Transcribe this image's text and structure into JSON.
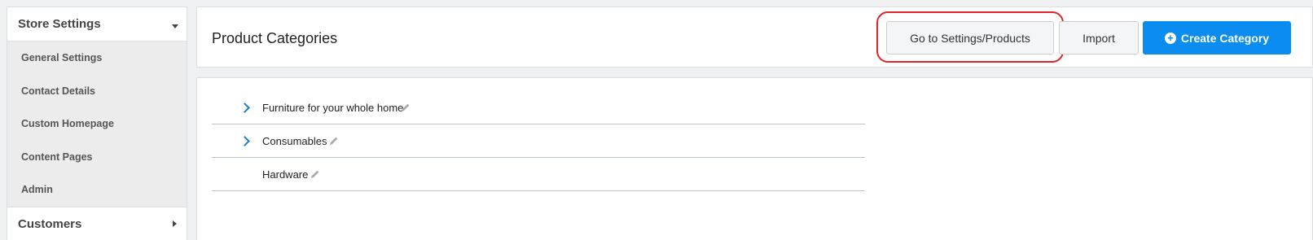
{
  "sidebar": {
    "sections": [
      {
        "title": "Store Settings",
        "expanded": true,
        "items": [
          {
            "label": "General Settings"
          },
          {
            "label": "Contact Details"
          },
          {
            "label": "Custom Homepage"
          },
          {
            "label": "Content Pages"
          },
          {
            "label": "Admin"
          }
        ]
      },
      {
        "title": "Customers",
        "expanded": false
      }
    ]
  },
  "header": {
    "title": "Product Categories",
    "buttons": {
      "goto_settings": "Go to Settings/Products",
      "import": "Import",
      "create": "Create Category"
    },
    "highlighted_button": "goto_settings"
  },
  "categories": [
    {
      "name": "Furniture for your whole home",
      "has_children": true
    },
    {
      "name": "Consumables",
      "has_children": true
    },
    {
      "name": "Hardware",
      "has_children": false
    }
  ],
  "colors": {
    "accent": "#0a8cf0",
    "highlight": "#e0252a",
    "chevron": "#1a7fd6"
  },
  "icons": {
    "section_expanded": "caret-down-icon",
    "section_collapsed": "caret-right-icon",
    "expand_category": "chevron-right-icon",
    "edit": "pencil-icon",
    "create": "plus-circle-icon"
  }
}
